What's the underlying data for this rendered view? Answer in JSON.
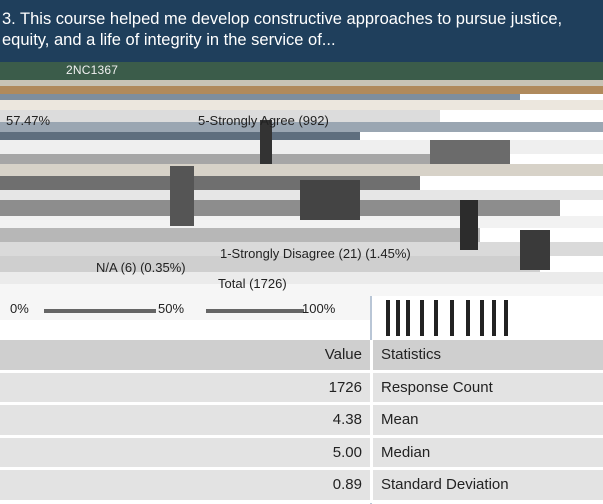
{
  "question": {
    "title": "3. This course helped me develop constructive approaches to pursue justice, equity, and a life of integrity in the service of..."
  },
  "chart": {
    "course_label": "2NC1367",
    "labels": {
      "strongly_agree": "5-Strongly Agree (992)",
      "strongly_agree_pct": "57.47%",
      "strongly_disagree": "1-Strongly Disagree (21) (1.45%)",
      "na": "N/A (6) (0.35%)",
      "total": "Total (1726)"
    },
    "axis": [
      "0%",
      "50%",
      "100%"
    ]
  },
  "stats": {
    "headers": {
      "value": "Value",
      "statistic": "Statistics"
    },
    "rows": [
      {
        "value": "1726",
        "statistic": "Response Count"
      },
      {
        "value": "4.38",
        "statistic": "Mean"
      },
      {
        "value": "5.00",
        "statistic": "Median"
      },
      {
        "value": "0.89",
        "statistic": "Standard Deviation"
      }
    ]
  },
  "colors": {
    "header": "#1f3f5c",
    "table_header": "#cfcfcf",
    "table_row": "#e3e3e3"
  }
}
